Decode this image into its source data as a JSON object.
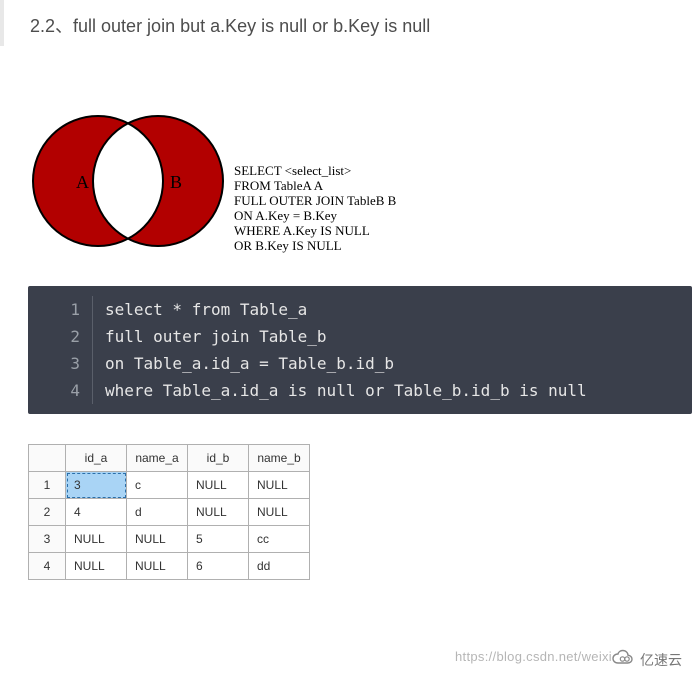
{
  "heading": "2.2、full outer join but a.Key is null or b.Key is null",
  "venn": {
    "left_label": "A",
    "right_label": "B"
  },
  "sql_caption": [
    "SELECT <select_list>",
    "FROM TableA A",
    "FULL OUTER JOIN TableB B",
    "ON A.Key = B.Key",
    "WHERE A.Key IS NULL",
    "OR B.Key IS NULL"
  ],
  "code_lines": [
    "select * from Table_a",
    "full outer join Table_b",
    "on Table_a.id_a = Table_b.id_b",
    "where Table_a.id_a is null or Table_b.id_b is null"
  ],
  "table": {
    "headers": [
      "id_a",
      "name_a",
      "id_b",
      "name_b"
    ],
    "rows": [
      {
        "n": "1",
        "cells": [
          "3",
          "c",
          "NULL",
          "NULL"
        ],
        "selected_col": 0
      },
      {
        "n": "2",
        "cells": [
          "4",
          "d",
          "NULL",
          "NULL"
        ]
      },
      {
        "n": "3",
        "cells": [
          "NULL",
          "NULL",
          "5",
          "cc"
        ]
      },
      {
        "n": "4",
        "cells": [
          "NULL",
          "NULL",
          "6",
          "dd"
        ]
      }
    ]
  },
  "watermark": "https://blog.csdn.net/weixi",
  "brand": "亿速云"
}
